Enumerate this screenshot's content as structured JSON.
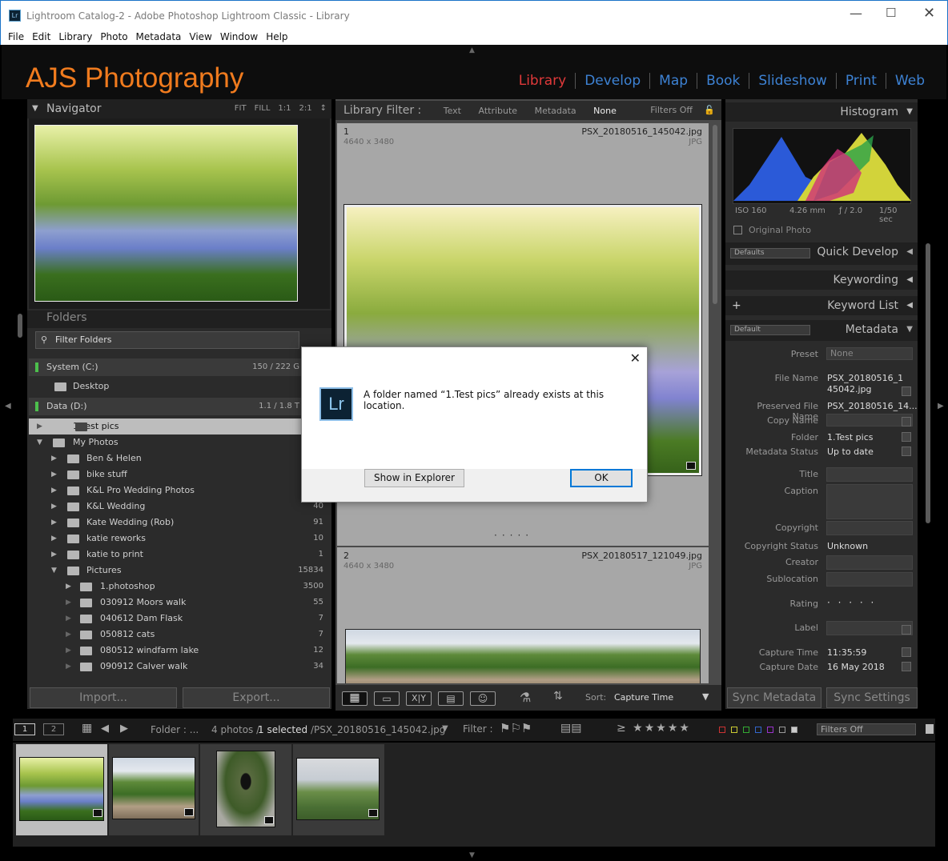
{
  "window": {
    "title": "Lightroom Catalog-2 - Adobe Photoshop Lightroom Classic - Library",
    "app_icon": "Lr"
  },
  "menu": [
    "File",
    "Edit",
    "Library",
    "Photo",
    "Metadata",
    "View",
    "Window",
    "Help"
  ],
  "identity_plate": "AJS Photography",
  "modules": [
    "Library",
    "Develop",
    "Map",
    "Book",
    "Slideshow",
    "Print",
    "Web"
  ],
  "navigator": {
    "title": "Navigator",
    "options": [
      "FIT",
      "FILL",
      "1:1",
      "2:1"
    ]
  },
  "folders": {
    "title": "Folders",
    "filter_placeholder": "Filter Folders",
    "volumes": [
      {
        "name": "System (C:)",
        "usage": "150 / 222 G"
      },
      {
        "name": "Data (D:)",
        "usage": "1.1 / 1.8 T"
      }
    ],
    "desktop": "Desktop",
    "test_pics": "1.Test pics",
    "my_photos": "My Photos",
    "items": [
      {
        "name": "Ben & Helen",
        "count": ""
      },
      {
        "name": "bike stuff",
        "count": ""
      },
      {
        "name": "K&L Pro Wedding Photos",
        "count": ""
      },
      {
        "name": "K&L Wedding",
        "count": "40"
      },
      {
        "name": "Kate Wedding (Rob)",
        "count": "91"
      },
      {
        "name": "katie reworks",
        "count": "10"
      },
      {
        "name": "katie to print",
        "count": "1"
      },
      {
        "name": "Pictures",
        "count": "15834"
      }
    ],
    "subitems": [
      {
        "name": "1.photoshop",
        "count": "3500"
      },
      {
        "name": "030912 Moors walk",
        "count": "55"
      },
      {
        "name": "040612 Dam Flask",
        "count": "7"
      },
      {
        "name": "050812 cats",
        "count": "7"
      },
      {
        "name": "080512 windfarm lake",
        "count": "12"
      },
      {
        "name": "090912 Calver walk",
        "count": "34"
      }
    ]
  },
  "left_buttons": {
    "import": "Import...",
    "export": "Export..."
  },
  "library_filter": {
    "label": "Library Filter :",
    "options": [
      "Text",
      "Attribute",
      "Metadata",
      "None"
    ],
    "status": "Filters Off"
  },
  "grid": [
    {
      "index": "1",
      "dimensions": "4640 x 3480",
      "filename": "PSX_20180516_145042.jpg",
      "type": "JPG"
    },
    {
      "index": "2",
      "dimensions": "4640 x 3480",
      "filename": "PSX_20180517_121049.jpg",
      "type": "JPG"
    }
  ],
  "toolbar": {
    "sort_label": "Sort:",
    "sort_value": "Capture Time"
  },
  "histogram": {
    "title": "Histogram",
    "iso": "ISO 160",
    "focal": "4.26 mm",
    "aperture": "ƒ / 2.0",
    "shutter": "1/50 sec",
    "original": "Original Photo"
  },
  "right_panels": {
    "quick_develop": "Quick Develop",
    "quick_develop_preset": "Defaults",
    "keywording": "Keywording",
    "keyword_list": "Keyword List",
    "metadata": "Metadata",
    "metadata_preset": "Default"
  },
  "metadata": [
    {
      "label": "Preset",
      "value": "None"
    },
    {
      "label": "File Name",
      "value": "PSX_20180516_1\n45042.jpg"
    },
    {
      "label": "Preserved File Name",
      "value": "PSX_20180516_14..."
    },
    {
      "label": "Copy Name",
      "value": ""
    },
    {
      "label": "Folder",
      "value": "1.Test pics"
    },
    {
      "label": "Metadata Status",
      "value": "Up to date"
    },
    {
      "label": "Title",
      "value": ""
    },
    {
      "label": "Caption",
      "value": ""
    },
    {
      "label": "Copyright",
      "value": ""
    },
    {
      "label": "Copyright Status",
      "value": "Unknown"
    },
    {
      "label": "Creator",
      "value": ""
    },
    {
      "label": "Sublocation",
      "value": ""
    },
    {
      "label": "Rating",
      "value": "· · · · ·"
    },
    {
      "label": "Label",
      "value": ""
    },
    {
      "label": "Capture Time",
      "value": "11:35:59"
    },
    {
      "label": "Capture Date",
      "value": "16 May 2018"
    }
  ],
  "right_buttons": {
    "sync_metadata": "Sync Metadata",
    "sync_settings": "Sync Settings"
  },
  "filmstrip": {
    "monitor1": "1",
    "monitor2": "2",
    "folder": "Folder : ...",
    "count": "4 photos /",
    "selected": "1 selected",
    "path": "/PSX_20180516_145042.jpg",
    "filter_label": "Filter :",
    "filters_off": "Filters Off",
    "stars": "≥ ★★★★★"
  },
  "dialog": {
    "icon": "Lr",
    "message": "A folder named “1.Test pics” already exists at this location.",
    "show_button": "Show in Explorer",
    "ok_button": "OK"
  },
  "colors": {
    "accent": "#3d82d4",
    "active_module": "#e0393a",
    "brand": "#f07b1e"
  }
}
